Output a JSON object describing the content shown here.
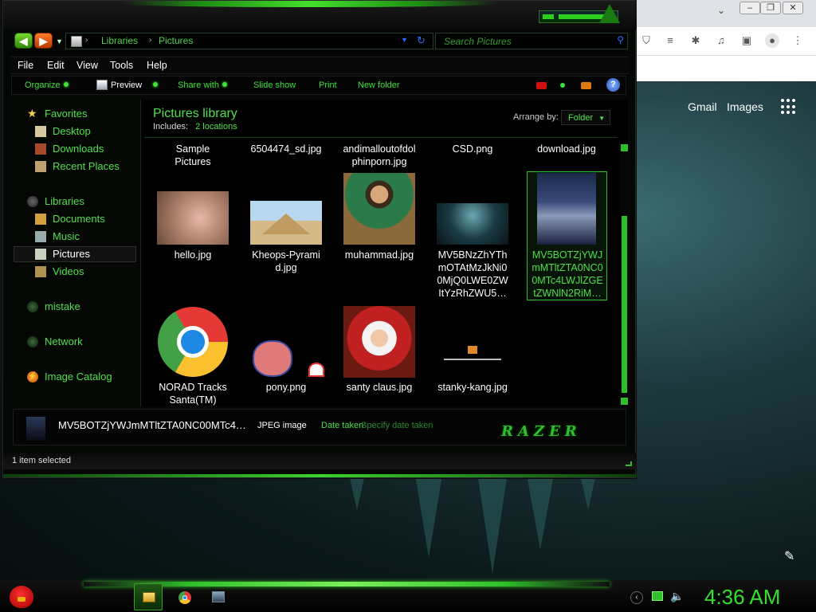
{
  "explorer": {
    "breadcrumb": [
      "Libraries",
      "Pictures"
    ],
    "search_placeholder": "Search Pictures",
    "menu": [
      "File",
      "Edit",
      "View",
      "Tools",
      "Help"
    ],
    "toolbar": [
      "Organize",
      "Preview",
      "Share with",
      "Slide show",
      "Print",
      "New folder"
    ],
    "help_glyph": "?",
    "nav": {
      "favorites": {
        "label": "Favorites",
        "items": [
          "Desktop",
          "Downloads",
          "Recent Places"
        ]
      },
      "libraries": {
        "label": "Libraries",
        "items": [
          "Documents",
          "Music",
          "Pictures",
          "Videos"
        ]
      },
      "other": [
        "mistake",
        "Network",
        "Image Catalog"
      ],
      "selected": "Pictures"
    },
    "library": {
      "title": "Pictures library",
      "includes_label": "Includes:",
      "includes_link": "2 locations",
      "arrange_label": "Arrange by:",
      "arrange_value": "Folder"
    },
    "items_row1": [
      "Sample\nPictures",
      "6504474_sd.jpg",
      "andimalloutofdol\nphinporn.jpg",
      "CSD.png",
      "download.jpg"
    ],
    "items_row2": [
      "hello.jpg",
      "Kheops-Pyrami\nd.jpg",
      "muhammad.jpg",
      "MV5BNzZhYTh\nmOTAtMzJkNi0\n0MjQ0LWE0ZW\nItYzRhZWU5…",
      "MV5BOTZjYWJ\nmMTltZTA0NC0\n0MTc4LWJlZGE\ntZWNlN2RiM…"
    ],
    "items_row3": [
      "NORAD Tracks\nSanta(TM)",
      "pony.png",
      "santy claus.jpg",
      "stanky-kang.jpg"
    ],
    "selected_item": "MV5BOTZjYWJmMTltZTA0NC0\n0MTc4LWJlZGE\ntZWNlN2RiM…",
    "details": {
      "name": "MV5BOTZjYWJmMTltZTA0NC00MTc4…",
      "type": "JPEG image",
      "date_label": "Date taken:",
      "date_value": "Specify date taken",
      "brand": "RAZER"
    },
    "status": "1 item selected"
  },
  "browser": {
    "links": [
      "Gmail",
      "Images"
    ]
  },
  "taskbar": {
    "clock": "4:36 AM",
    "tasks": [
      "explorer-icon",
      "chrome-icon",
      "settings-icon"
    ]
  },
  "colors": {
    "accent": "#4fe04a",
    "background": "#000000",
    "clock": "#35e02a"
  }
}
